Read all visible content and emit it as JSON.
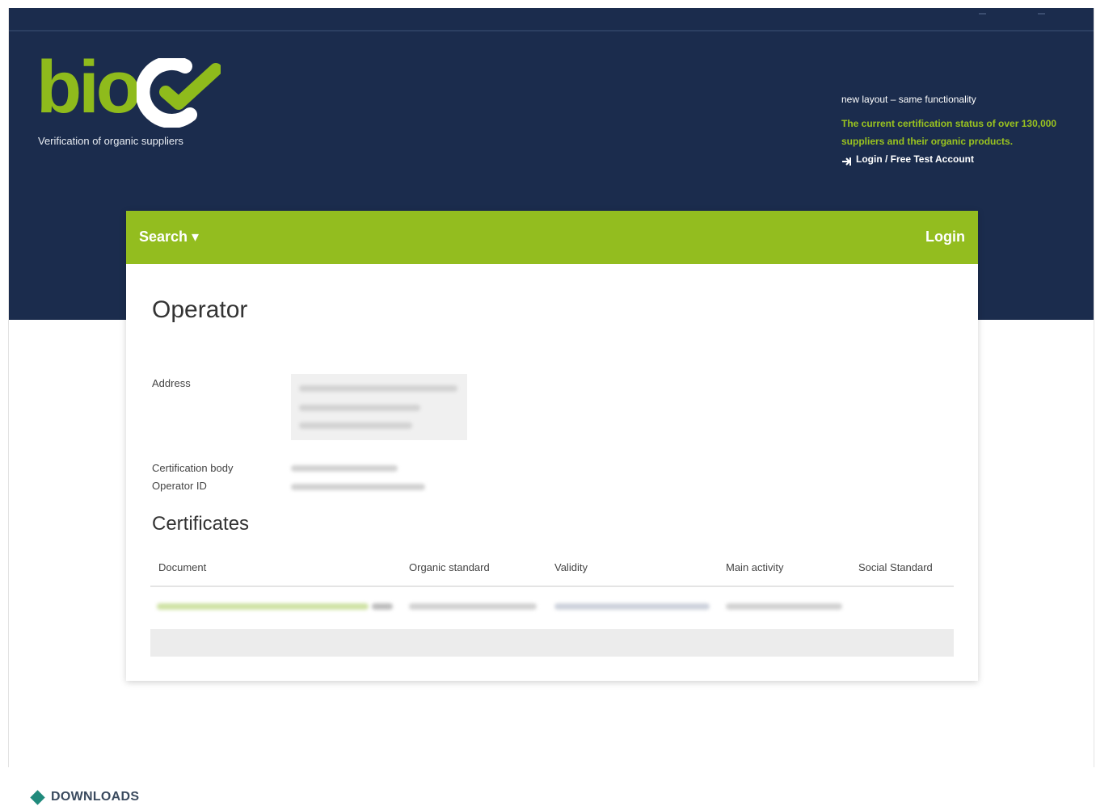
{
  "brand": {
    "logo_text": "bio",
    "tagline": "Verification of organic suppliers",
    "green": "#93bd1f",
    "navy": "#1b2c4d"
  },
  "hero": {
    "note": "new layout – same functionality",
    "status": "The current certification status of over 130,000 suppliers and their organic products.",
    "login_link": "Login / Free Test Account"
  },
  "navbar": {
    "search_label": "Search ▾",
    "login_label": "Login"
  },
  "operator": {
    "title": "Operator",
    "address_label": "Address",
    "certification_body_label": "Certification body",
    "operator_id_label": "Operator ID"
  },
  "certificates": {
    "title": "Certificates",
    "columns": [
      "Document",
      "Organic standard",
      "Validity",
      "Main activity",
      "Social Standard"
    ]
  },
  "downloads": {
    "label": "DOWNLOADS"
  }
}
